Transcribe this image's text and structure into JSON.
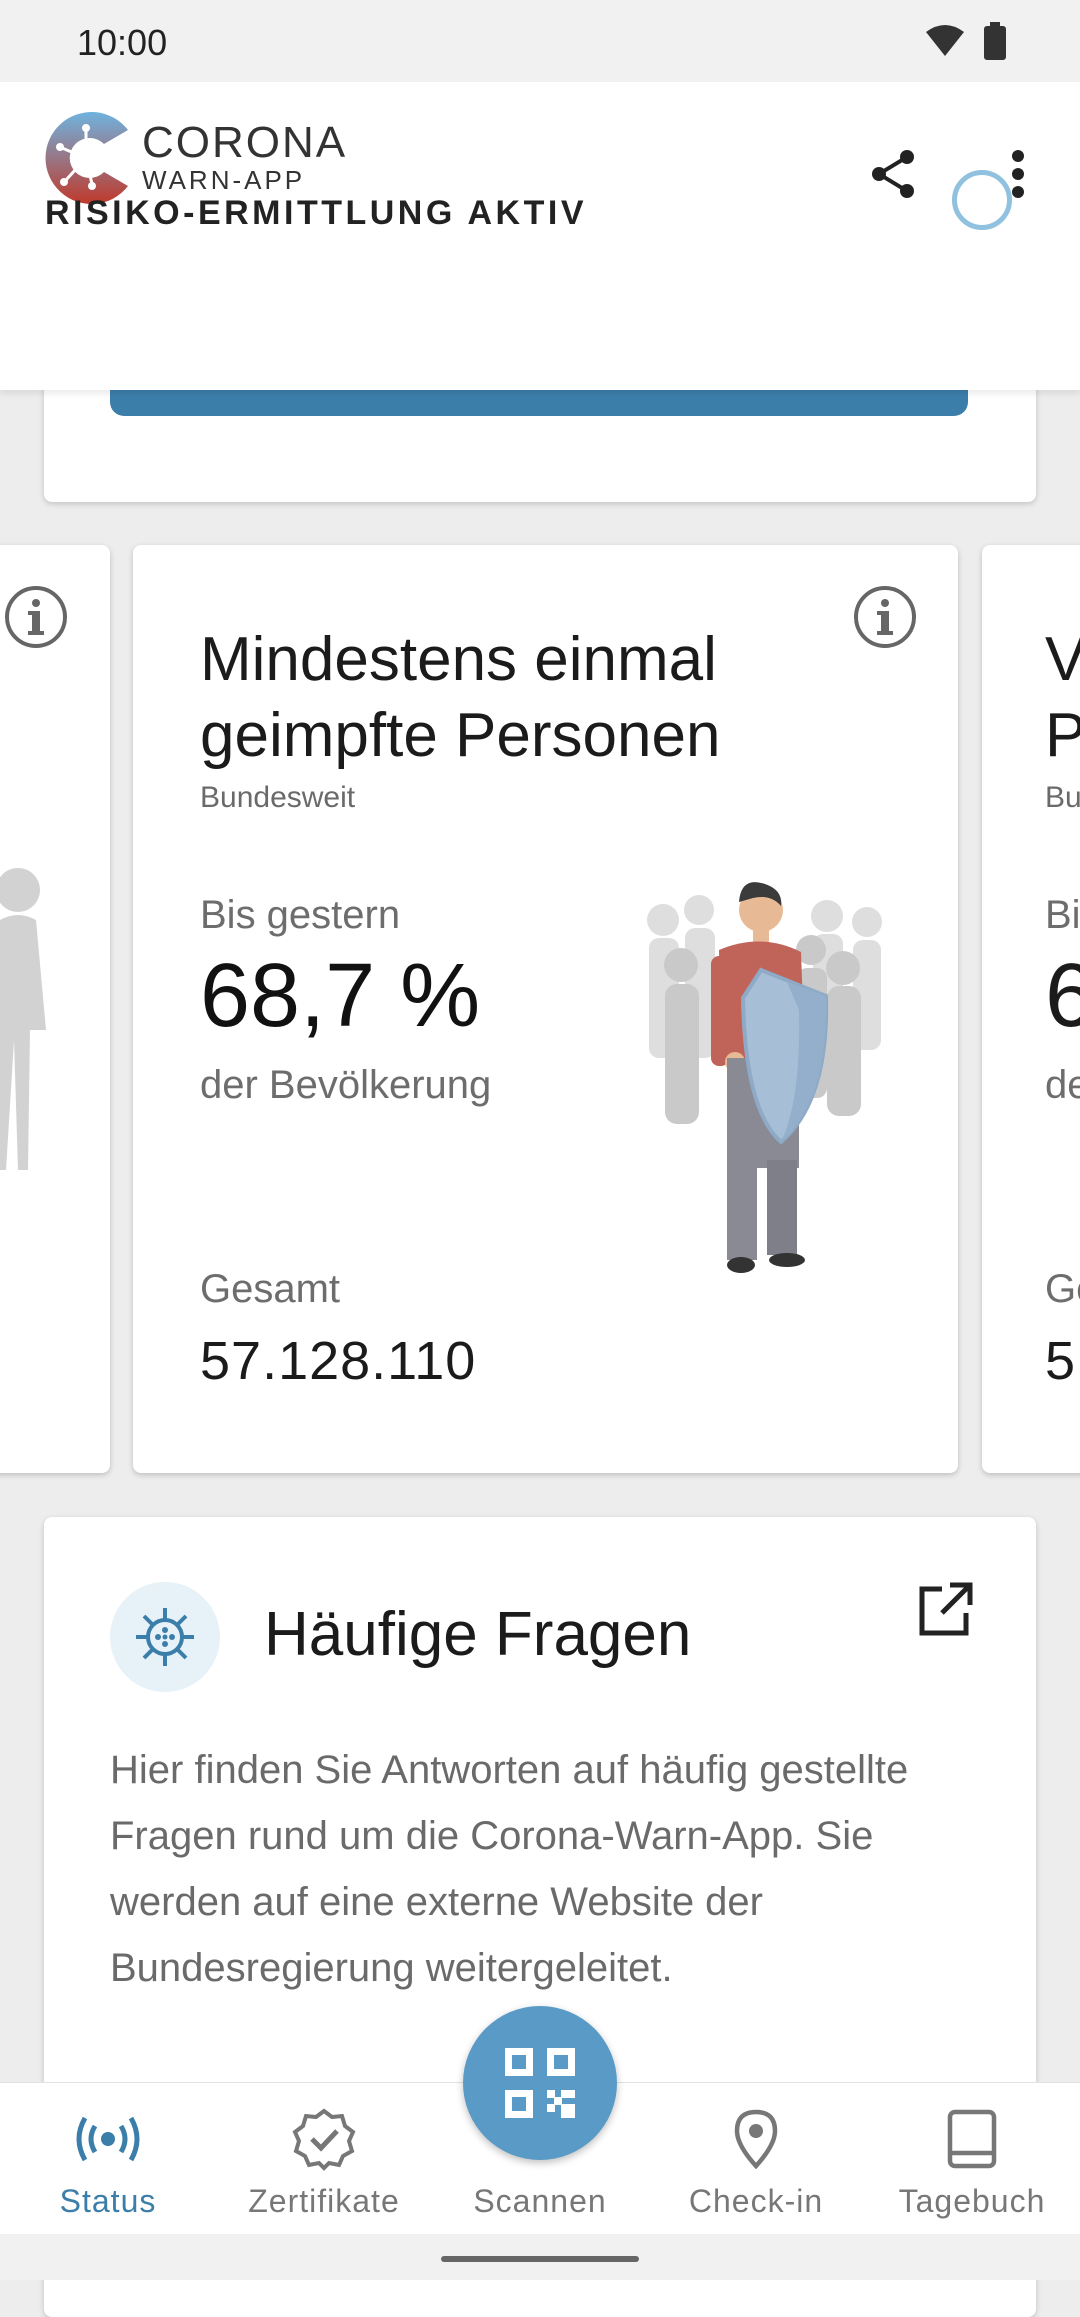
{
  "status_bar": {
    "time": "10:00"
  },
  "app": {
    "logo_title": "CORONA",
    "logo_subtitle": "WARN-APP"
  },
  "risk": {
    "label": "RISIKO-ERMITTLUNG AKTIV"
  },
  "stat_card": {
    "title": "Mindestens einmal geimpfte Personen",
    "subtitle": "Bundesweit",
    "primary_label": "Bis gestern",
    "primary_value": "68,7 %",
    "primary_suffix": "der Bevölkerung",
    "secondary_label": "Gesamt",
    "secondary_value": "57.128.110"
  },
  "next_card_peek": {
    "title_l1": "V",
    "title_l2": "P",
    "subtitle": "Bu",
    "label1": "Bi",
    "value1": "6",
    "suffix": "de",
    "label2": "Ge",
    "value2": "5"
  },
  "faq": {
    "title": "Häufige Fragen",
    "body": "Hier finden Sie Antworten auf häufig gestellte Fragen rund um die Corona-Warn-App. Sie werden auf eine externe Website der Bundesregierung weitergeleitet."
  },
  "bottom_nav": {
    "items": [
      {
        "label": "Status",
        "icon": "broadcast-icon",
        "active": true
      },
      {
        "label": "Zertifikate",
        "icon": "certificate-icon",
        "active": false
      },
      {
        "label": "Scannen",
        "icon": "qr-code-icon",
        "active": false
      },
      {
        "label": "Check-in",
        "icon": "location-pin-icon",
        "active": false
      },
      {
        "label": "Tagebuch",
        "icon": "book-icon",
        "active": false
      }
    ]
  },
  "colors": {
    "accent": "#3c7eaa",
    "fab": "#5a9ac6",
    "risk_indicator": "#90c1de"
  }
}
